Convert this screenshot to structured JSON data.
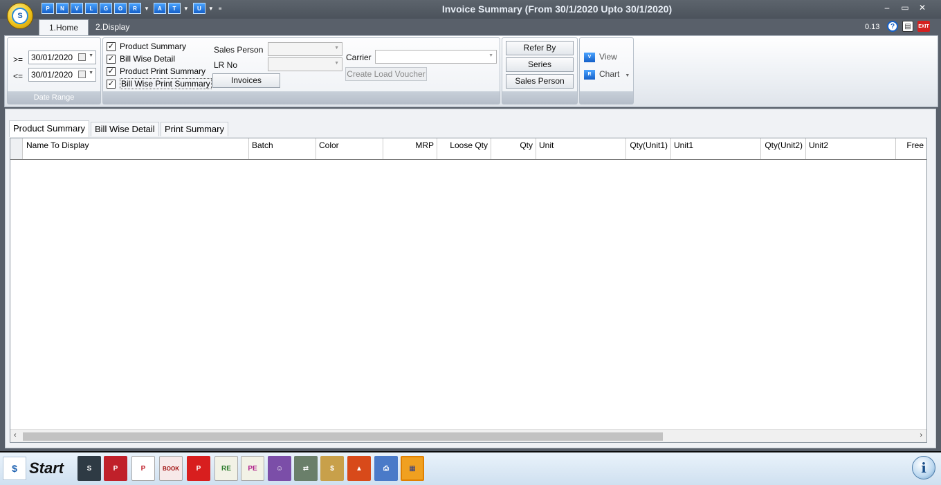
{
  "window": {
    "title": "Invoice Summary (From 30/1/2020 Upto 30/1/2020)",
    "version": "0.13",
    "logo_text": "S"
  },
  "quick_access": [
    "P",
    "N",
    "V",
    "L",
    "G",
    "O",
    "R",
    "A",
    "T",
    "U"
  ],
  "ribbon_tabs": [
    {
      "label": "1.Home",
      "active": true
    },
    {
      "label": "2.Display",
      "active": false
    }
  ],
  "date_range": {
    "from_op": ">=",
    "from_value": "30/01/2020",
    "to_op": "<=",
    "to_value": "30/01/2020",
    "group_label": "Date Range"
  },
  "options": {
    "checkboxes": [
      {
        "label": "Product Summary",
        "checked": true
      },
      {
        "label": "Bill Wise Detail",
        "checked": true
      },
      {
        "label": "Product Print Summary",
        "checked": true
      },
      {
        "label": "Bill Wise Print Summary",
        "checked": true
      }
    ],
    "sales_person_label": "Sales Person",
    "sales_person_value": "",
    "lr_no_label": "LR No",
    "lr_no_value": "",
    "carrier_label": "Carrier",
    "carrier_value": "",
    "invoices_button": "Invoices",
    "create_load_voucher_button": "Create Load Voucher"
  },
  "filters": {
    "refer_by_button": "Refer By",
    "series_button": "Series",
    "sales_person_button": "Sales Person"
  },
  "view_group": {
    "view_label": "View",
    "chart_label": "Chart"
  },
  "content_tabs": [
    {
      "label": "Product Summary",
      "active": true
    },
    {
      "label": "Bill Wise Detail",
      "active": false
    },
    {
      "label": "Print Summary",
      "active": false
    }
  ],
  "grid": {
    "columns": [
      "Name To Display",
      "Batch",
      "Color",
      "MRP",
      "Loose Qty",
      "Qty",
      "Unit",
      "Qty(Unit1)",
      "Unit1",
      "Qty(Unit2)",
      "Unit2",
      "Free"
    ],
    "rows": []
  },
  "taskbar": {
    "start_label": "Start",
    "icons": [
      "stock-icon",
      "purchase-icon",
      "sales-icon",
      "order-book-icon",
      "print-icon",
      "receipt-entry-icon",
      "payment-entry-icon",
      "user-icon",
      "transfer-icon",
      "money-bag-icon",
      "shapes-icon",
      "printer-icon",
      "calculator-icon"
    ]
  },
  "colors": {
    "title_bar": "#4b525b",
    "ribbon_bg": "#e9edf2",
    "accent_blue": "#1460c8",
    "taskbar_bg": "#cfe0f0"
  }
}
